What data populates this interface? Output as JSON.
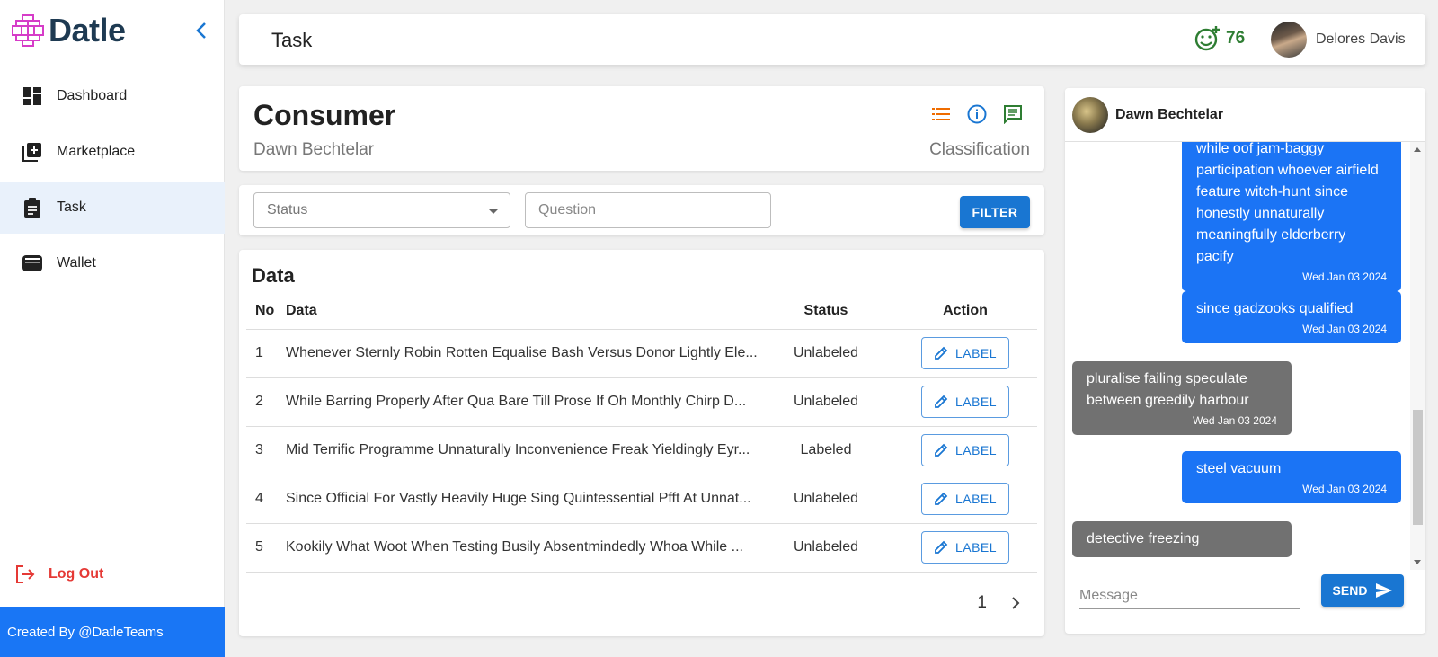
{
  "app": {
    "name": "Datle"
  },
  "sidebar": {
    "items": [
      {
        "label": "Dashboard",
        "icon": "dashboard-icon"
      },
      {
        "label": "Marketplace",
        "icon": "add-box-icon"
      },
      {
        "label": "Task",
        "icon": "clipboard-icon",
        "active": true
      },
      {
        "label": "Wallet",
        "icon": "wallet-icon"
      }
    ],
    "logout": "Log Out",
    "footer": "Created By @DatleTeams"
  },
  "header": {
    "title": "Task",
    "points": "76",
    "user_name": "Delores Davis"
  },
  "consumer": {
    "title": "Consumer",
    "owner": "Dawn Bechtelar",
    "type": "Classification"
  },
  "filter": {
    "status_placeholder": "Status",
    "question_placeholder": "Question",
    "button": "FILTER"
  },
  "data_table": {
    "title": "Data",
    "headers": {
      "no": "No",
      "data": "Data",
      "status": "Status",
      "action": "Action"
    },
    "rows": [
      {
        "no": "1",
        "data": "Whenever Sternly Robin Rotten Equalise Bash Versus Donor Lightly Ele...",
        "status": "Unlabeled",
        "action": "LABEL"
      },
      {
        "no": "2",
        "data": "While Barring Properly After Qua Bare Till Prose If Oh Monthly Chirp D...",
        "status": "Unlabeled",
        "action": "LABEL"
      },
      {
        "no": "3",
        "data": "Mid Terrific Programme Unnaturally Inconvenience Freak Yieldingly Eyr...",
        "status": "Labeled",
        "action": "LABEL"
      },
      {
        "no": "4",
        "data": "Since Official For Vastly Heavily Huge Sing Quintessential Pfft At Unnat...",
        "status": "Unlabeled",
        "action": "LABEL"
      },
      {
        "no": "5",
        "data": "Kookily What Woot When Testing Busily Absentmindedly Whoa While ...",
        "status": "Unlabeled",
        "action": "LABEL"
      }
    ],
    "page": "1"
  },
  "chat": {
    "contact": "Dawn Bechtelar",
    "messages": [
      {
        "dir": "out",
        "text": "while oof jam-baggy participation whoever airfield feature witch-hunt since honestly unnaturally meaningfully elderberry pacify",
        "time": "Wed Jan 03 2024"
      },
      {
        "dir": "out",
        "text": "since gadzooks qualified",
        "time": "Wed Jan 03 2024"
      },
      {
        "dir": "in",
        "text": "pluralise failing speculate between greedily harbour",
        "time": "Wed Jan 03 2024"
      },
      {
        "dir": "out",
        "text": "steel vacuum",
        "time": "Wed Jan 03 2024"
      },
      {
        "dir": "in",
        "text": "detective freezing",
        "time": ""
      }
    ],
    "message_placeholder": "Message",
    "send": "SEND"
  },
  "colors": {
    "accent": "#1976d2",
    "outgoing": "#1b74f5",
    "incoming": "#717171",
    "logout": "#e53935",
    "points": "#2e7d32",
    "logo": "#1e3a52",
    "logo_mark": "#d63cc8"
  }
}
